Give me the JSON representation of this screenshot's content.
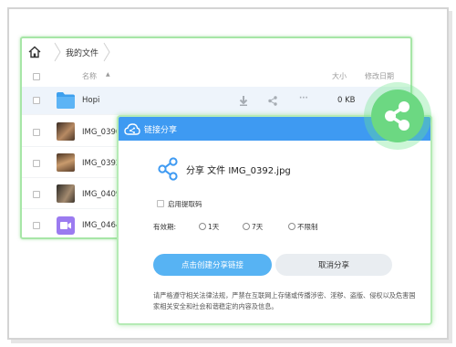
{
  "breadcrumb": {
    "current": "我的文件"
  },
  "table": {
    "col_name": "名称",
    "col_size": "大小",
    "col_date": "修改日期",
    "rows": [
      {
        "name": "Hopi",
        "size": "0 KB",
        "kind": "folder"
      },
      {
        "name": "IMG_0390",
        "size": "",
        "kind": "image"
      },
      {
        "name": "IMG_0392",
        "size": "",
        "kind": "image"
      },
      {
        "name": "IMG_0409",
        "size": "",
        "kind": "image"
      },
      {
        "name": "IMG_0464",
        "size": "",
        "kind": "video"
      }
    ],
    "row_actions": {
      "download": "download-icon",
      "share": "share-icon",
      "more": "···"
    }
  },
  "dialog": {
    "title": "链接分享",
    "share_file_text": "分享 文件 IMG_0392.jpg",
    "extract_code_label": "启用提取码",
    "validity_label": "有效期:",
    "validity_options": [
      "1天",
      "7天",
      "不限制"
    ],
    "create_button": "点击创建分享链接",
    "cancel_button": "取消分享",
    "notice": "请严格遵守相关法律法规，严禁在互联网上存储或传播涉密、淫秽、盗版、侵权以及危害国家相关安全和社会和谐稳定的内容及信息。"
  },
  "colors": {
    "accent": "#3e9af2",
    "button": "#57b3f3",
    "highlight": "#6cd882"
  }
}
